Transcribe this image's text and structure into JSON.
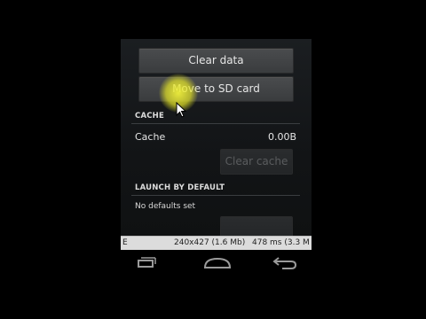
{
  "buttons": {
    "clear_data": "Clear data",
    "move_to_sd": "Move to SD card",
    "clear_cache": "Clear cache"
  },
  "cache": {
    "header": "CACHE",
    "label": "Cache",
    "value": "0.00B"
  },
  "launch": {
    "header": "LAUNCH BY DEFAULT",
    "text": "No defaults set"
  },
  "statusbar": {
    "left": "E",
    "dimensions": "240x427 (1.6 Mb)",
    "timing": "478 ms (3.3 M"
  },
  "nav_icons": [
    "recent-apps-icon",
    "home-icon",
    "back-icon"
  ],
  "colors": {
    "highlight": "#e8e830",
    "background": "#141618"
  }
}
